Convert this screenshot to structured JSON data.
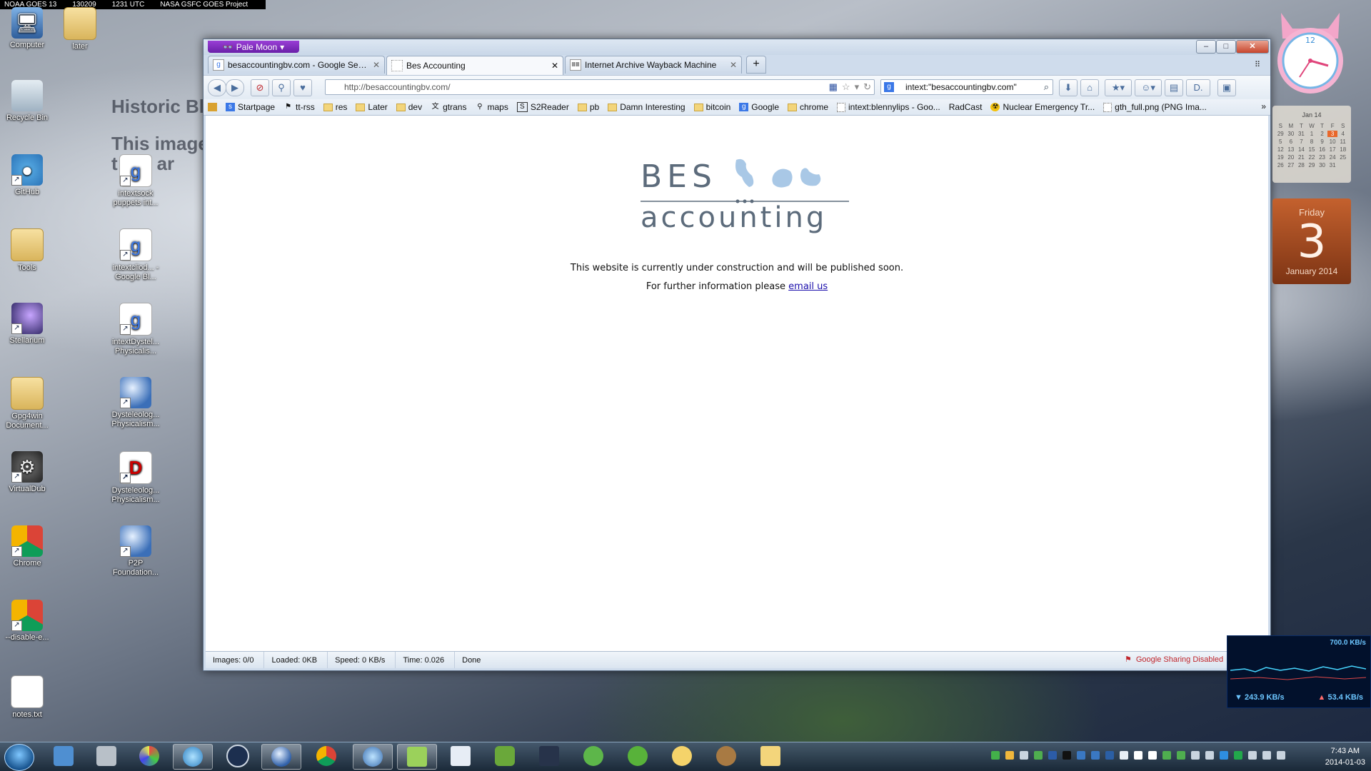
{
  "wallpaper": {
    "banner": [
      "NOAA GOES 13",
      "130209",
      "1231 UTC",
      "NASA GSFC GOES Project"
    ],
    "text_line1": "Historic Bliz",
    "text_line2": "This image",
    "text_line3": "t   her ar"
  },
  "desktop_icons": [
    {
      "label": "Computer",
      "icon": "computer-icon"
    },
    {
      "label": "later",
      "icon": "folder-icon"
    },
    {
      "label": "Recycle Bin",
      "icon": "recycle-bin-icon"
    },
    {
      "label": "GitHub",
      "icon": "github-icon"
    },
    {
      "label": "intextsock puppets int...",
      "icon": "google-doc-icon"
    },
    {
      "label": "Tools",
      "icon": "folder-icon"
    },
    {
      "label": "intextcliod... - Google Bl...",
      "icon": "google-doc-icon"
    },
    {
      "label": "Stellarium",
      "icon": "stellarium-icon"
    },
    {
      "label": "intextDystel... Physicalis...",
      "icon": "google-doc-icon"
    },
    {
      "label": "Gpg4win Document...",
      "icon": "folder-icon"
    },
    {
      "label": "Dysteleolog... Physicalism...",
      "icon": "globe-icon"
    },
    {
      "label": "VirtualDub",
      "icon": "virtualdub-icon"
    },
    {
      "label": "Dysteleolog... Physicalism...",
      "icon": "pdf-icon"
    },
    {
      "label": "Chrome",
      "icon": "chrome-icon"
    },
    {
      "label": "P2P Foundation...",
      "icon": "globe-icon"
    },
    {
      "label": "--disable-e...",
      "icon": "chrome-icon"
    },
    {
      "label": "notes.txt",
      "icon": "text-file-icon"
    }
  ],
  "browser": {
    "app_menu": "Pale Moon",
    "window_controls": {
      "minimize": "–",
      "maximize": "□",
      "close": "✕"
    },
    "tabs": [
      {
        "label": "besaccountingbv.com - Google Search",
        "favicon": "g",
        "active": false
      },
      {
        "label": "Bes Accounting",
        "favicon": "",
        "active": true
      },
      {
        "label": "Internet Archive Wayback Machine",
        "favicon": "ⅢⅢ",
        "active": false
      }
    ],
    "new_tab": "+",
    "tab_list": "⠿",
    "url": "http://besaccountingbv.com/",
    "search_text": "intext:\"besaccountingbv.com\"",
    "bookmarks": [
      {
        "label": "Startpage",
        "icon": "page"
      },
      {
        "label": "tt-rss",
        "icon": "page"
      },
      {
        "label": "res",
        "icon": "folder"
      },
      {
        "label": "Later",
        "icon": "folder"
      },
      {
        "label": "dev",
        "icon": "folder"
      },
      {
        "label": "gtrans",
        "icon": "page"
      },
      {
        "label": "maps",
        "icon": "page"
      },
      {
        "label": "S2Reader",
        "icon": "page"
      },
      {
        "label": "pb",
        "icon": "folder"
      },
      {
        "label": "Damn Interesting",
        "icon": "folder"
      },
      {
        "label": "bitcoin",
        "icon": "folder"
      },
      {
        "label": "Google",
        "icon": "g"
      },
      {
        "label": "chrome",
        "icon": "folder"
      },
      {
        "label": "intext:blennylips - Goo...",
        "icon": "page"
      },
      {
        "label": "RadCast",
        "icon": "page"
      },
      {
        "label": "Nuclear Emergency Tr...",
        "icon": "page"
      },
      {
        "label": "gth_full.png (PNG Ima...",
        "icon": "page"
      }
    ],
    "bookmarks_overflow": "»",
    "page": {
      "logo_top": "BES",
      "logo_bottom": "accounting",
      "line1": "This website is currently under construction and will be published soon.",
      "line2_prefix": "For further information please ",
      "line2_link": "email us"
    },
    "status": {
      "images": "Images: 0/0",
      "loaded": "Loaded: 0KB",
      "speed": "Speed: 0 KB/s",
      "time": "Time: 0.026",
      "state": "Done",
      "sharing": "Google Sharing Disabled"
    }
  },
  "gadgets": {
    "clock_number": "12",
    "calendar": {
      "month": "Jan 14",
      "weekdays": [
        "S",
        "M",
        "T",
        "W",
        "T",
        "F",
        "S"
      ],
      "days": [
        "29",
        "30",
        "31",
        "1",
        "2",
        "3",
        "4",
        "5",
        "6",
        "7",
        "8",
        "9",
        "10",
        "11",
        "12",
        "13",
        "14",
        "15",
        "16",
        "17",
        "18",
        "19",
        "20",
        "21",
        "22",
        "23",
        "24",
        "25",
        "26",
        "27",
        "28",
        "29",
        "30",
        "31",
        " "
      ],
      "today": "3"
    },
    "datecard": {
      "weekday": "Friday",
      "day": "3",
      "month_year": "January 2014"
    },
    "network": {
      "peak": "700.0 KB/s",
      "down": "243.9 KB/s",
      "up": "53.4 KB/s"
    }
  },
  "taskbar": {
    "time": "7:43 AM",
    "date": "2014-01-03",
    "apps": [
      "explorer-icon",
      "camera-icon",
      "paint-icon",
      "network-icon",
      "keepass-icon",
      "palemoon-icon",
      "chrome-icon",
      "thunderbird-icon",
      "notepadpp-icon",
      "pencil-icon",
      "evernote-icon",
      "monitor-icon",
      "python-icon",
      "utorrent-icon",
      "search-icon",
      "gimp-icon",
      "folder-icon"
    ]
  }
}
